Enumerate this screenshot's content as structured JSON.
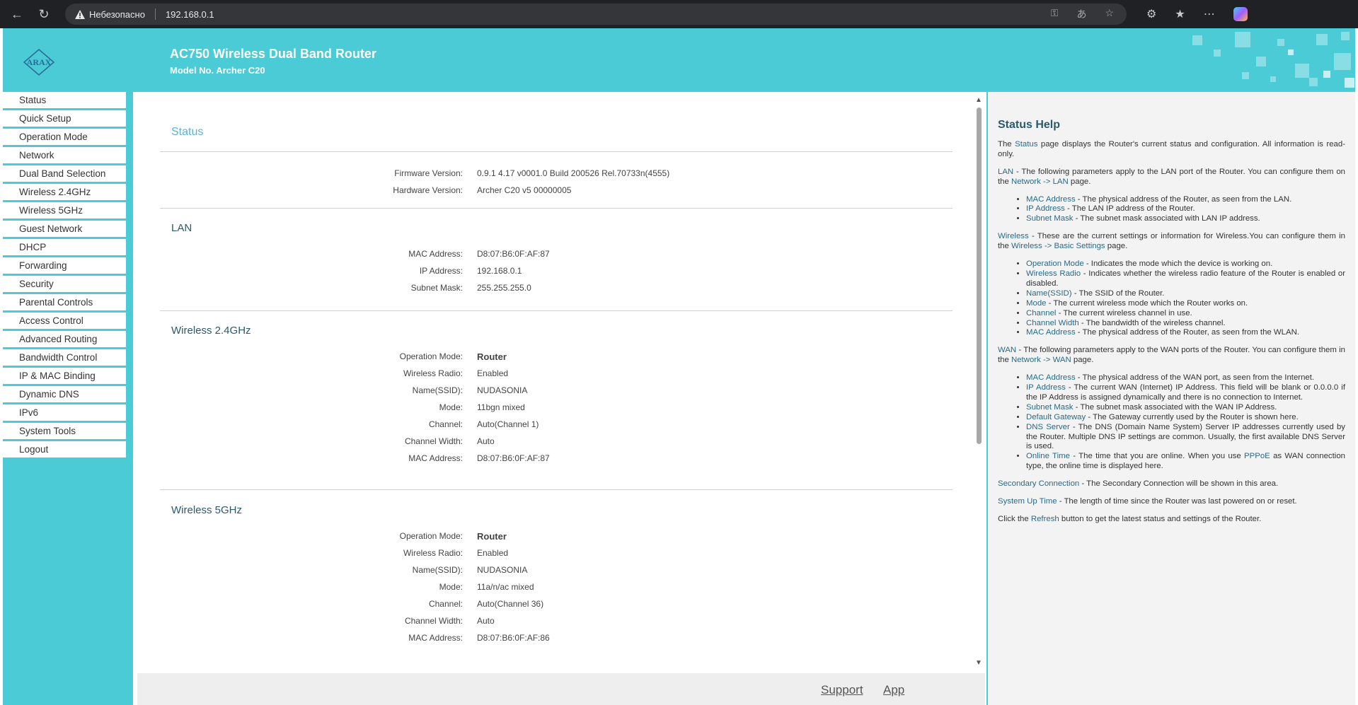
{
  "browser": {
    "security_text": "Небезопасно",
    "url": "192.168.0.1"
  },
  "header": {
    "logo_text": "ARAX",
    "product_title": "AC750 Wireless Dual Band Router",
    "model_no": "Model No. Archer C20"
  },
  "sidebar": {
    "items": [
      {
        "label": "Status"
      },
      {
        "label": "Quick Setup"
      },
      {
        "label": "Operation Mode"
      },
      {
        "label": "Network"
      },
      {
        "label": "Dual Band Selection"
      },
      {
        "label": "Wireless 2.4GHz"
      },
      {
        "label": "Wireless 5GHz"
      },
      {
        "label": "Guest Network"
      },
      {
        "label": "DHCP"
      },
      {
        "label": "Forwarding"
      },
      {
        "label": "Security"
      },
      {
        "label": "Parental Controls"
      },
      {
        "label": "Access Control"
      },
      {
        "label": "Advanced Routing"
      },
      {
        "label": "Bandwidth Control"
      },
      {
        "label": "IP & MAC Binding"
      },
      {
        "label": "Dynamic DNS"
      },
      {
        "label": "IPv6"
      },
      {
        "label": "System Tools"
      },
      {
        "label": "Logout"
      }
    ]
  },
  "status": {
    "title": "Status",
    "firmware_label": "Firmware Version:",
    "firmware_value": "0.9.1 4.17 v0001.0 Build 200526 Rel.70733n(4555)",
    "hardware_label": "Hardware Version:",
    "hardware_value": "Archer C20 v5 00000005"
  },
  "lan": {
    "title": "LAN",
    "rows": [
      {
        "label": "MAC Address:",
        "value": "D8:07:B6:0F:AF:87"
      },
      {
        "label": "IP Address:",
        "value": "192.168.0.1"
      },
      {
        "label": "Subnet Mask:",
        "value": "255.255.255.0"
      }
    ]
  },
  "wireless24": {
    "title": "Wireless 2.4GHz",
    "rows": [
      {
        "label": "Operation Mode:",
        "value": "Router"
      },
      {
        "label": "Wireless Radio:",
        "value": "Enabled"
      },
      {
        "label": "Name(SSID):",
        "value": "NUDASONIA"
      },
      {
        "label": "Mode:",
        "value": "11bgn mixed"
      },
      {
        "label": "Channel:",
        "value": "Auto(Channel 1)"
      },
      {
        "label": "Channel Width:",
        "value": "Auto"
      },
      {
        "label": "MAC Address:",
        "value": "D8:07:B6:0F:AF:87"
      }
    ]
  },
  "wireless5": {
    "title": "Wireless 5GHz",
    "rows": [
      {
        "label": "Operation Mode:",
        "value": "Router"
      },
      {
        "label": "Wireless Radio:",
        "value": "Enabled"
      },
      {
        "label": "Name(SSID):",
        "value": "NUDASONIA"
      },
      {
        "label": "Mode:",
        "value": "11a/n/ac mixed"
      },
      {
        "label": "Channel:",
        "value": "Auto(Channel 36)"
      },
      {
        "label": "Channel Width:",
        "value": "Auto"
      },
      {
        "label": "MAC Address:",
        "value": "D8:07:B6:0F:AF:86"
      }
    ]
  },
  "footer": {
    "support": "Support",
    "app": "App"
  },
  "help": {
    "title": "Status Help",
    "intro_pre": "The ",
    "intro_kw": "Status",
    "intro_post": " page displays the Router's current status and configuration. All information is read-only.",
    "lan_kw": "LAN",
    "lan_text": " - The following parameters apply to the LAN port of the Router. You can configure them on the ",
    "lan_link1": "Network",
    "lan_arrow": " -> ",
    "lan_link2": "LAN",
    "lan_end": " page.",
    "lan_items": [
      {
        "kw": "MAC Address",
        "text": " - The physical address of the Router, as seen from the LAN."
      },
      {
        "kw": "IP Address",
        "text": " - The LAN IP address of the Router."
      },
      {
        "kw": "Subnet Mask",
        "text": " - The subnet mask associated with LAN IP address."
      }
    ],
    "wl_kw": "Wireless",
    "wl_text": " - These are the current settings or information for Wireless.You can configure them in the ",
    "wl_link1": "Wireless",
    "wl_arrow": " -> ",
    "wl_link2": "Basic Settings",
    "wl_end": " page.",
    "wl_items": [
      {
        "kw": "Operation Mode",
        "text": " - Indicates the mode which the device is working on."
      },
      {
        "kw": "Wireless Radio",
        "text": " - Indicates whether the wireless radio feature of the Router is enabled or disabled."
      },
      {
        "kw": "Name(SSID)",
        "text": " - The SSID of the Router."
      },
      {
        "kw": "Mode",
        "text": " - The current wireless mode which the Router works on."
      },
      {
        "kw": "Channel",
        "text": " - The current wireless channel in use."
      },
      {
        "kw": "Channel Width",
        "text": " - The bandwidth of the wireless channel."
      },
      {
        "kw": "MAC Address",
        "text": " - The physical address of the Router, as seen from the WLAN."
      }
    ],
    "wan_kw": "WAN",
    "wan_text": " - The following parameters apply to the WAN ports of the Router. You can configure them in the ",
    "wan_link1": "Network",
    "wan_arrow": " -> ",
    "wan_link2": "WAN",
    "wan_end": " page.",
    "wan_items": [
      {
        "kw": "MAC Address",
        "text": " - The physical address of the WAN port, as seen from the Internet."
      },
      {
        "kw": "IP Address",
        "text": " - The current WAN (Internet) IP Address. This field will be blank or 0.0.0.0 if the IP Address is assigned dynamically and there is no connection to Internet."
      },
      {
        "kw": "Subnet Mask",
        "text": " - The subnet mask associated with the WAN IP Address."
      },
      {
        "kw": "Default Gateway",
        "text": " - The Gateway currently used by the Router is shown here."
      },
      {
        "kw": "DNS Server",
        "text": " - The DNS (Domain Name System) Server IP addresses currently used by the Router. Multiple DNS IP settings are common. Usually, the first available DNS Server is used."
      }
    ],
    "online_kw": "Online Time",
    "online_text1": " - The time that you are online. When you use ",
    "online_kw2": "PPPoE",
    "online_text2": " as WAN connection type, the online time is displayed here.",
    "sec_kw": "Secondary Connection",
    "sec_text": " - The Secondary Connection will be shown in this area.",
    "up_kw": "System Up Time",
    "up_text": " - The length of time since the Router was last powered on or reset.",
    "refresh_pre": "Click the ",
    "refresh_kw": "Refresh",
    "refresh_post": " button to get the latest status and settings of the Router."
  }
}
